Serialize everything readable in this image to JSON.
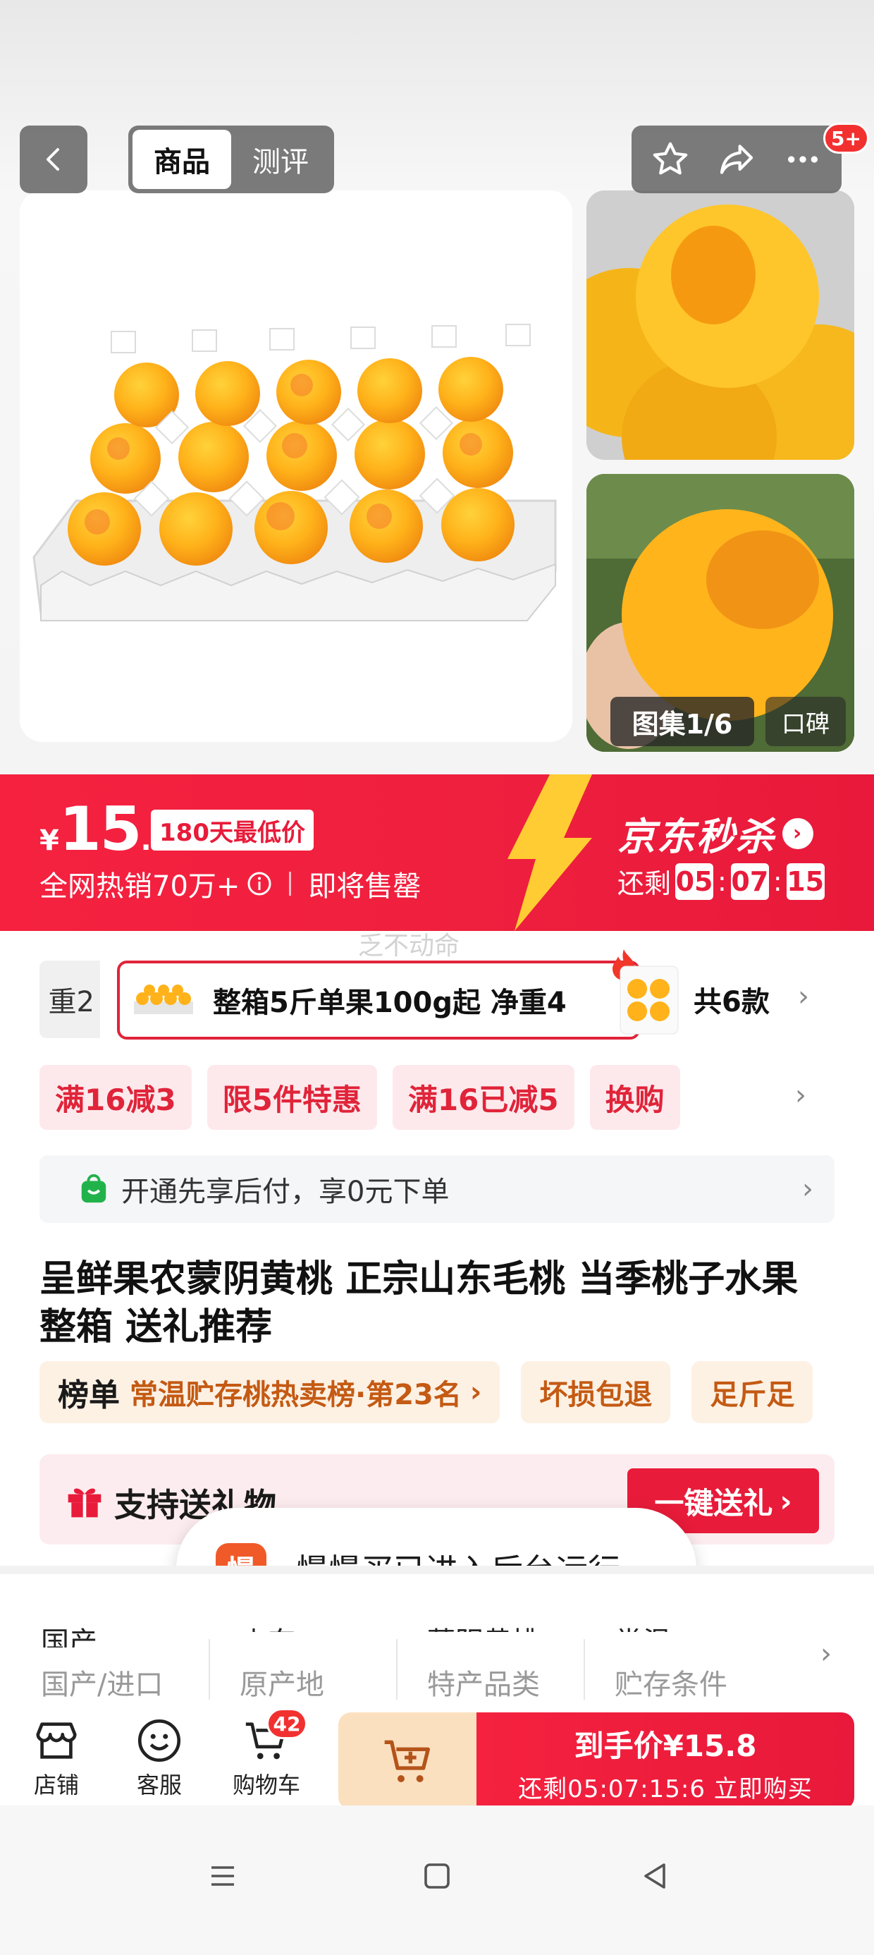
{
  "header": {
    "tabs": [
      {
        "label": "商品",
        "active": true
      },
      {
        "label": "测评",
        "active": false
      }
    ],
    "more_badge": "5+"
  },
  "gallery": {
    "counter": "图集1/6",
    "review_label": "口碑"
  },
  "price_banner": {
    "currency": "¥",
    "price_int": "15",
    "price_dec": ".8",
    "lowest_tag": "180天最低价",
    "hot_sales": "全网热销70万+",
    "sellout": "即将售罄",
    "seckill_title": "京东秒杀",
    "remaining_label": "还剩",
    "countdown": [
      "05",
      "07",
      "15"
    ],
    "accent_color": "#ef1f3e"
  },
  "watermark": "乏不动命",
  "specs": {
    "prev_label": "重2",
    "selected": "整箱5斤单果100g起 净重4",
    "total": "共6款"
  },
  "promotions": [
    "满16减3",
    "限5件特惠",
    "满16已减5",
    "换购"
  ],
  "paylater": "开通先享后付，享0元下单",
  "product_title": "呈鲜果农蒙阴黄桃 正宗山东毛桃 当季桃子水果整箱 送礼推荐",
  "tags": {
    "rank_lead": "榜单",
    "rank_text": "常温贮存桃热卖榜·第23名",
    "items": [
      "坏损包退",
      "足斤足"
    ]
  },
  "gift": {
    "text": "支持送礼物",
    "button": "一键送礼"
  },
  "toast": {
    "app_icon_text": "慢",
    "message": "慢慢买已进入后台运行"
  },
  "attributes": [
    {
      "value": "国产",
      "key": "国产/进口"
    },
    {
      "value": "山东",
      "key": "原产地"
    },
    {
      "value": "蒙阴黄桃",
      "key": "特产品类"
    },
    {
      "value": "常温",
      "key": "贮存条件"
    }
  ],
  "bottom_bar": {
    "store": "店铺",
    "service": "客服",
    "cart": "购物车",
    "cart_count": "42",
    "buy_line1": "到手价¥15.8",
    "buy_line2": "还剩05:07:15:6 立即购买"
  }
}
